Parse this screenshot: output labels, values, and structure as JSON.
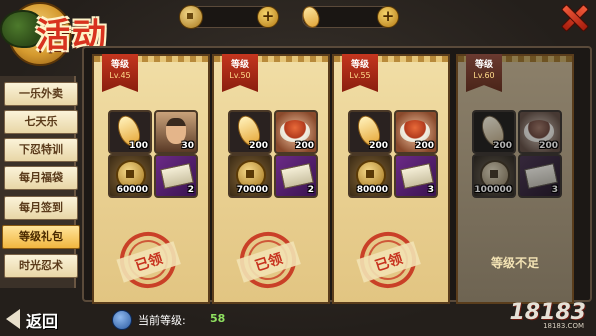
{
  "header": {
    "title": "活动",
    "currency": [
      {
        "icon": "coin-icon"
      },
      {
        "icon": "bread-icon"
      }
    ],
    "add_label": "+"
  },
  "sidebar": {
    "items": [
      {
        "label": "一乐外卖",
        "active": false
      },
      {
        "label": "七天乐",
        "active": false
      },
      {
        "label": "下忍特训",
        "active": false
      },
      {
        "label": "每月福袋",
        "active": false
      },
      {
        "label": "每月签到",
        "active": false
      },
      {
        "label": "等级礼包",
        "active": true
      },
      {
        "label": "时光忍术",
        "active": false
      }
    ]
  },
  "cards": [
    {
      "level_label": "等级",
      "level": "Lv.45",
      "status": "claimed",
      "stamp": "已领",
      "items": [
        {
          "icon": "bread-icon",
          "qty": "100"
        },
        {
          "icon": "ninja-portrait-icon",
          "qty": "30"
        },
        {
          "icon": "coins-icon",
          "qty": "60000"
        },
        {
          "icon": "scroll-icon",
          "qty": "2"
        }
      ]
    },
    {
      "level_label": "等级",
      "level": "Lv.50",
      "status": "claimed",
      "stamp": "已领",
      "items": [
        {
          "icon": "bread-icon",
          "qty": "200"
        },
        {
          "icon": "food-bowl-icon",
          "qty": "200"
        },
        {
          "icon": "coins-icon",
          "qty": "70000"
        },
        {
          "icon": "scroll-icon",
          "qty": "2"
        }
      ]
    },
    {
      "level_label": "等级",
      "level": "Lv.55",
      "status": "claimed",
      "stamp": "已领",
      "items": [
        {
          "icon": "bread-icon",
          "qty": "200"
        },
        {
          "icon": "food-bowl-icon",
          "qty": "200"
        },
        {
          "icon": "coins-icon",
          "qty": "80000"
        },
        {
          "icon": "scroll-icon",
          "qty": "3"
        }
      ]
    },
    {
      "level_label": "等级",
      "level": "Lv.60",
      "status": "locked",
      "note": "等级不足",
      "items": [
        {
          "icon": "bread-icon",
          "qty": "200"
        },
        {
          "icon": "food-bowl-icon",
          "qty": "200"
        },
        {
          "icon": "coins-icon",
          "qty": "100000"
        },
        {
          "icon": "scroll-icon",
          "qty": "3"
        }
      ]
    }
  ],
  "footer": {
    "back_label": "返回",
    "current_level_label": "当前等级:",
    "current_level_value": "58",
    "watermark": "18183",
    "watermark_sub": "18183.COM"
  }
}
